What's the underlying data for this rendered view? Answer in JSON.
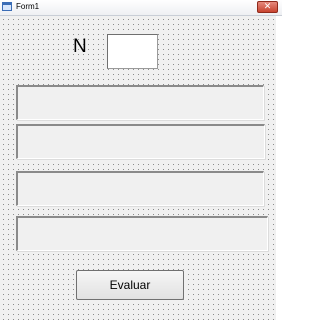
{
  "window": {
    "title": "Form1",
    "close_glyph": "✕",
    "icons": {
      "app": "form-window-icon",
      "close": "close-icon"
    }
  },
  "form": {
    "n_label": "N",
    "n_input_value": "",
    "output_boxes": [
      "",
      "",
      "",
      ""
    ],
    "evaluate_button_label": "Evaluar"
  },
  "colors": {
    "form_background": "#f0f0f0",
    "grid_dots": "#8c8c8c",
    "close_button": "#c7432f"
  }
}
